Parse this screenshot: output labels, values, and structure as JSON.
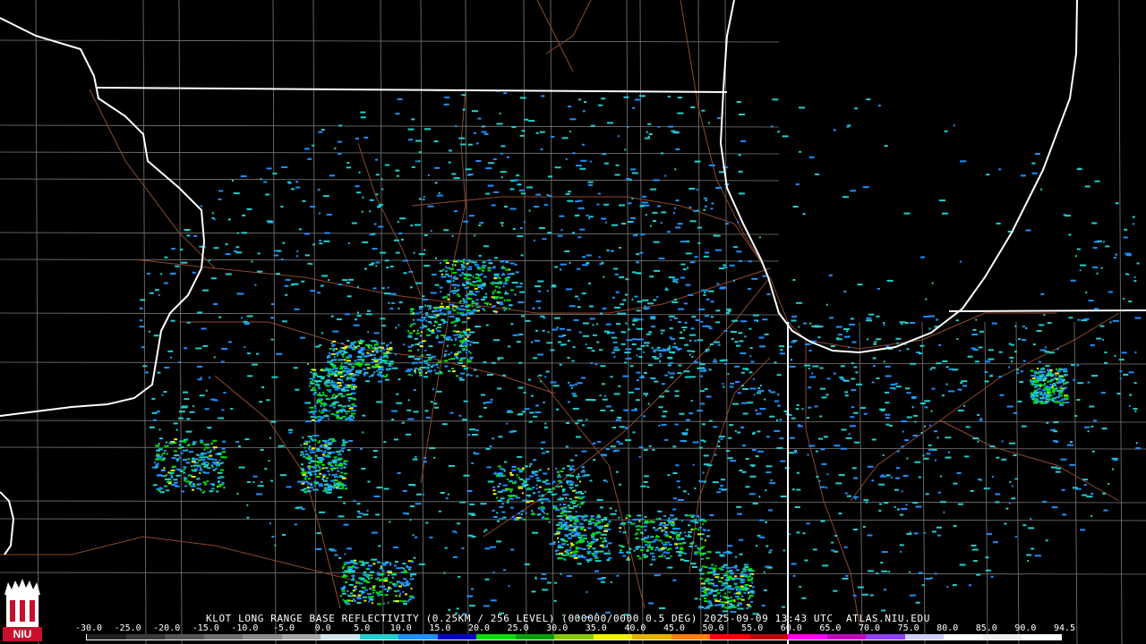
{
  "title": "KLOT LONG RANGE BASE REFLECTIVITY (0.25KM / 256 LEVEL) (000000/0000 0.5 DEG) 2025-09-09 13:43 UTC  ATLAS.NIU.EDU",
  "logo_text": "NIU",
  "scale": {
    "labels": [
      "-30.0",
      "-25.0",
      "-20.0",
      "-15.0",
      "-10.0",
      "-5.0",
      "0.0",
      "5.0",
      "10.0",
      "15.0",
      "20.0",
      "25.0",
      "30.0",
      "35.0",
      "40.0",
      "45.0",
      "50.0",
      "55.0",
      "60.0",
      "65.0",
      "70.0",
      "75.0",
      "80.0",
      "85.0",
      "90.0",
      "94.5"
    ],
    "colors": [
      "#202020",
      "#3a3a3a",
      "#555555",
      "#707070",
      "#8a8a8a",
      "#a8a8a8",
      "#cfe8f0",
      "#20d0d0",
      "#1e90ff",
      "#0000c8",
      "#00e000",
      "#00a000",
      "#88c800",
      "#f0f000",
      "#e8b000",
      "#ff8000",
      "#ff0000",
      "#c00000",
      "#ff00ff",
      "#c000c0",
      "#9040ff",
      "#d0d0ff",
      "#ffffff",
      "#f0f0f0",
      "#ffffff"
    ]
  },
  "colors": {
    "state_border": "#ffffff",
    "county_border": "#8a8a8a",
    "roads": "#8b4a2e",
    "reflectivity_low": "#1e90ff",
    "reflectivity_mid": "#20d0d0",
    "reflectivity_high": "#00e000",
    "reflectivity_peak": "#f0f000"
  }
}
